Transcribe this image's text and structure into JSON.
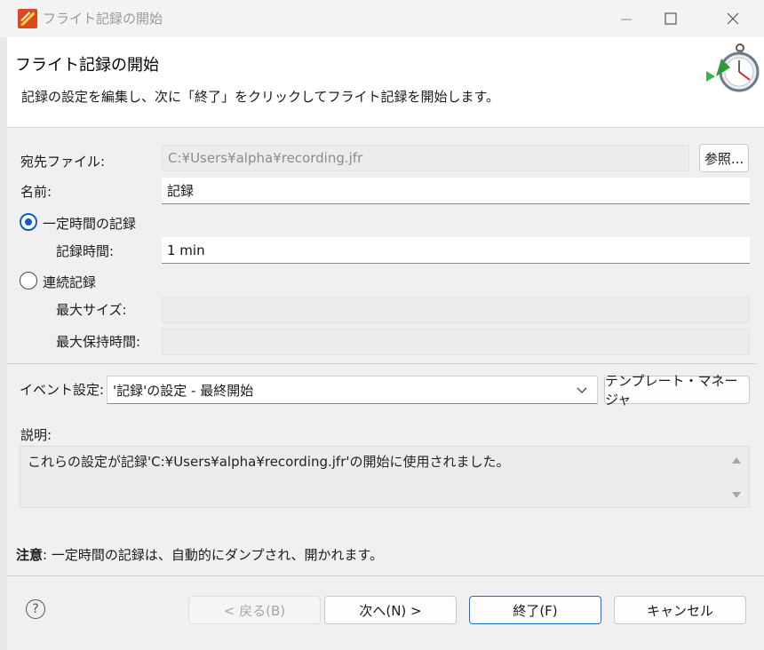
{
  "window": {
    "title": "フライト記録の開始"
  },
  "header": {
    "title": "フライト記録の開始",
    "description": "記録の設定を編集し、次に「終了」をクリックしてフライト記録を開始します。"
  },
  "form": {
    "destination_label": "宛先ファイル:",
    "destination_value": "C:¥Users¥alpha¥recording.jfr",
    "browse_label": "参照...",
    "name_label": "名前:",
    "name_value": "記録",
    "fixed_radio_label": "一定時間の記録",
    "fixed_selected": true,
    "duration_label": "記録時間:",
    "duration_value": "1 min",
    "continuous_radio_label": "連続記録",
    "max_size_label": "最大サイズ:",
    "max_age_label": "最大保持時間:",
    "event_settings_label": "イベント設定:",
    "event_settings_value": "'記録'の設定 - 最終開始",
    "template_manager_label": "テンプレート・マネージャ",
    "description_label": "説明:",
    "description_text": "これらの設定が記録'C:¥Users¥alpha¥recording.jfr'の開始に使用されました。",
    "note_bold": "注意",
    "note_text": ": 一定時間の記録は、自動的にダンプされ、開かれます。"
  },
  "buttons": {
    "back": "< 戻る(B)",
    "next": "次へ(N) >",
    "finish": "終了(F)",
    "cancel": "キャンセル",
    "help": "?"
  },
  "colors": {
    "accent": "#0f5cc0",
    "content_bg": "#f0f0f0",
    "disabled_text": "#8c8c8c"
  }
}
